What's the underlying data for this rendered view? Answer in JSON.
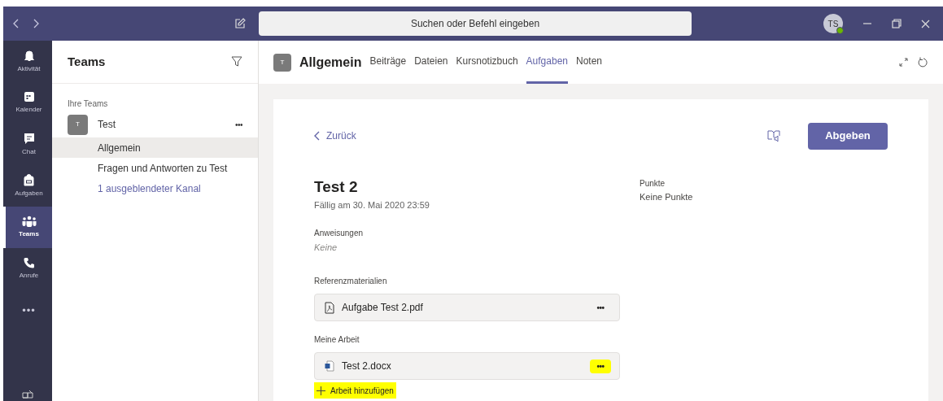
{
  "title_bar": {
    "search": {
      "placeholder": "Suchen oder Befehl eingeben"
    },
    "avatar": "TS"
  },
  "rail": [
    {
      "label": "Aktivität",
      "kind": "bell",
      "selected": false
    },
    {
      "label": "Kalender",
      "kind": "calendar",
      "selected": false
    },
    {
      "label": "Chat",
      "kind": "chat",
      "selected": false
    },
    {
      "label": "Aufgaben",
      "kind": "bag",
      "selected": false
    },
    {
      "label": "Teams",
      "kind": "teams",
      "selected": true
    },
    {
      "label": "Anrufe",
      "kind": "phone",
      "selected": false
    },
    {
      "label": "•••",
      "kind": "more",
      "selected": false
    }
  ],
  "sidebar": {
    "title": "Teams",
    "section": "Ihre Teams",
    "team": {
      "initial": "T",
      "name": "Test",
      "more": "•••"
    },
    "channels": [
      {
        "label": "Allgemein",
        "selected": true,
        "kind": "channel"
      },
      {
        "label": "Fragen und Antworten zu Test",
        "selected": false,
        "kind": "channel"
      },
      {
        "label": "1 ausgeblendeter Kanal",
        "selected": false,
        "kind": "link"
      }
    ]
  },
  "header": {
    "initial": "T",
    "channel": "Allgemein",
    "tabs": [
      {
        "label": "Beiträge",
        "selected": false
      },
      {
        "label": "Dateien",
        "selected": false
      },
      {
        "label": "Kursnotizbuch",
        "selected": false
      },
      {
        "label": "Aufgaben",
        "selected": true
      },
      {
        "label": "Noten",
        "selected": false
      }
    ]
  },
  "assignment": {
    "back": "Zurück",
    "submit": "Abgeben",
    "title": "Test 2",
    "due": "Fällig am 30. Mai 2020 23:59",
    "points_label": "Punkte",
    "points": "Keine Punkte",
    "instructions_label": "Anweisungen",
    "instructions": "Keine",
    "reference_label": "Referenzmaterialien",
    "reference_files": [
      {
        "name": "Aufgabe Test 2.pdf",
        "kind": "pdf",
        "more": "•••",
        "highlighted": false
      }
    ],
    "work_label": "Meine Arbeit",
    "work_files": [
      {
        "name": "Test 2.docx",
        "kind": "word",
        "more": "•••",
        "highlighted": true
      }
    ],
    "add_work": {
      "label": "Arbeit hinzufügen",
      "highlighted": true
    }
  }
}
